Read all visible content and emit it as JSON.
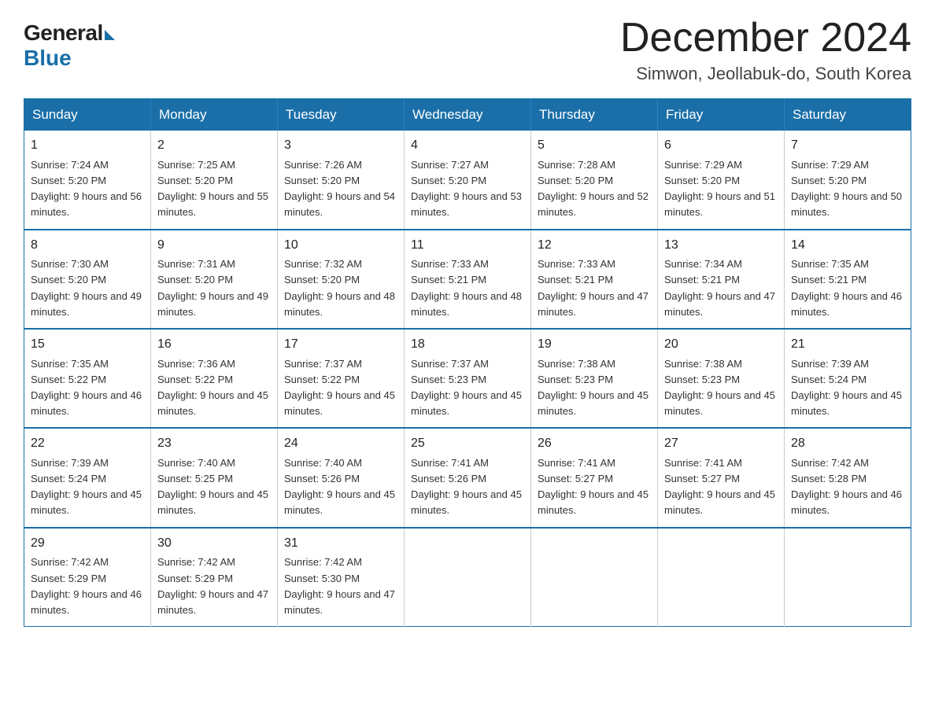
{
  "logo": {
    "general": "General",
    "blue": "Blue"
  },
  "header": {
    "title": "December 2024",
    "subtitle": "Simwon, Jeollabuk-do, South Korea"
  },
  "weekdays": [
    "Sunday",
    "Monday",
    "Tuesday",
    "Wednesday",
    "Thursday",
    "Friday",
    "Saturday"
  ],
  "weeks": [
    [
      {
        "day": "1",
        "sunrise": "7:24 AM",
        "sunset": "5:20 PM",
        "daylight": "9 hours and 56 minutes."
      },
      {
        "day": "2",
        "sunrise": "7:25 AM",
        "sunset": "5:20 PM",
        "daylight": "9 hours and 55 minutes."
      },
      {
        "day": "3",
        "sunrise": "7:26 AM",
        "sunset": "5:20 PM",
        "daylight": "9 hours and 54 minutes."
      },
      {
        "day": "4",
        "sunrise": "7:27 AM",
        "sunset": "5:20 PM",
        "daylight": "9 hours and 53 minutes."
      },
      {
        "day": "5",
        "sunrise": "7:28 AM",
        "sunset": "5:20 PM",
        "daylight": "9 hours and 52 minutes."
      },
      {
        "day": "6",
        "sunrise": "7:29 AM",
        "sunset": "5:20 PM",
        "daylight": "9 hours and 51 minutes."
      },
      {
        "day": "7",
        "sunrise": "7:29 AM",
        "sunset": "5:20 PM",
        "daylight": "9 hours and 50 minutes."
      }
    ],
    [
      {
        "day": "8",
        "sunrise": "7:30 AM",
        "sunset": "5:20 PM",
        "daylight": "9 hours and 49 minutes."
      },
      {
        "day": "9",
        "sunrise": "7:31 AM",
        "sunset": "5:20 PM",
        "daylight": "9 hours and 49 minutes."
      },
      {
        "day": "10",
        "sunrise": "7:32 AM",
        "sunset": "5:20 PM",
        "daylight": "9 hours and 48 minutes."
      },
      {
        "day": "11",
        "sunrise": "7:33 AM",
        "sunset": "5:21 PM",
        "daylight": "9 hours and 48 minutes."
      },
      {
        "day": "12",
        "sunrise": "7:33 AM",
        "sunset": "5:21 PM",
        "daylight": "9 hours and 47 minutes."
      },
      {
        "day": "13",
        "sunrise": "7:34 AM",
        "sunset": "5:21 PM",
        "daylight": "9 hours and 47 minutes."
      },
      {
        "day": "14",
        "sunrise": "7:35 AM",
        "sunset": "5:21 PM",
        "daylight": "9 hours and 46 minutes."
      }
    ],
    [
      {
        "day": "15",
        "sunrise": "7:35 AM",
        "sunset": "5:22 PM",
        "daylight": "9 hours and 46 minutes."
      },
      {
        "day": "16",
        "sunrise": "7:36 AM",
        "sunset": "5:22 PM",
        "daylight": "9 hours and 45 minutes."
      },
      {
        "day": "17",
        "sunrise": "7:37 AM",
        "sunset": "5:22 PM",
        "daylight": "9 hours and 45 minutes."
      },
      {
        "day": "18",
        "sunrise": "7:37 AM",
        "sunset": "5:23 PM",
        "daylight": "9 hours and 45 minutes."
      },
      {
        "day": "19",
        "sunrise": "7:38 AM",
        "sunset": "5:23 PM",
        "daylight": "9 hours and 45 minutes."
      },
      {
        "day": "20",
        "sunrise": "7:38 AM",
        "sunset": "5:23 PM",
        "daylight": "9 hours and 45 minutes."
      },
      {
        "day": "21",
        "sunrise": "7:39 AM",
        "sunset": "5:24 PM",
        "daylight": "9 hours and 45 minutes."
      }
    ],
    [
      {
        "day": "22",
        "sunrise": "7:39 AM",
        "sunset": "5:24 PM",
        "daylight": "9 hours and 45 minutes."
      },
      {
        "day": "23",
        "sunrise": "7:40 AM",
        "sunset": "5:25 PM",
        "daylight": "9 hours and 45 minutes."
      },
      {
        "day": "24",
        "sunrise": "7:40 AM",
        "sunset": "5:26 PM",
        "daylight": "9 hours and 45 minutes."
      },
      {
        "day": "25",
        "sunrise": "7:41 AM",
        "sunset": "5:26 PM",
        "daylight": "9 hours and 45 minutes."
      },
      {
        "day": "26",
        "sunrise": "7:41 AM",
        "sunset": "5:27 PM",
        "daylight": "9 hours and 45 minutes."
      },
      {
        "day": "27",
        "sunrise": "7:41 AM",
        "sunset": "5:27 PM",
        "daylight": "9 hours and 45 minutes."
      },
      {
        "day": "28",
        "sunrise": "7:42 AM",
        "sunset": "5:28 PM",
        "daylight": "9 hours and 46 minutes."
      }
    ],
    [
      {
        "day": "29",
        "sunrise": "7:42 AM",
        "sunset": "5:29 PM",
        "daylight": "9 hours and 46 minutes."
      },
      {
        "day": "30",
        "sunrise": "7:42 AM",
        "sunset": "5:29 PM",
        "daylight": "9 hours and 47 minutes."
      },
      {
        "day": "31",
        "sunrise": "7:42 AM",
        "sunset": "5:30 PM",
        "daylight": "9 hours and 47 minutes."
      },
      null,
      null,
      null,
      null
    ]
  ]
}
